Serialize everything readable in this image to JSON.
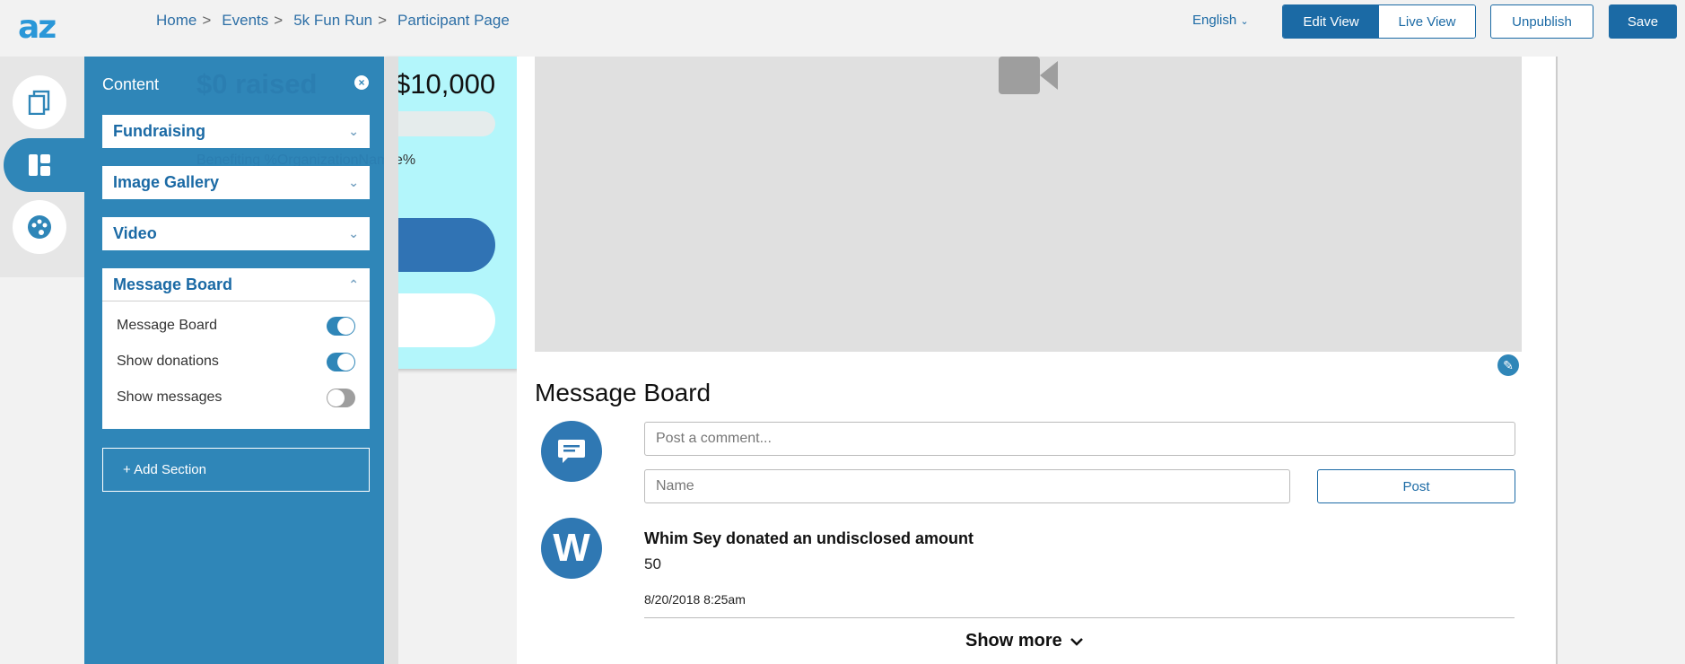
{
  "header": {
    "logo": "az",
    "breadcrumbs": [
      "Home",
      "Events",
      "5k Fun Run",
      "Participant Page"
    ],
    "breadcrumb_separator": ">",
    "language": "English",
    "edit_view": "Edit View",
    "live_view": "Live View",
    "unpublish": "Unpublish",
    "save": "Save"
  },
  "rail": {
    "items": [
      {
        "icon": "pages-icon"
      },
      {
        "icon": "layout-icon",
        "active": true
      },
      {
        "icon": "palette-icon"
      }
    ]
  },
  "panel": {
    "title": "Content",
    "sections": [
      "Fundraising",
      "Image Gallery",
      "Video",
      "Message Board"
    ],
    "expanded": {
      "title": "Message Board",
      "options": [
        {
          "label": "Message Board",
          "on": true
        },
        {
          "label": "Show donations",
          "on": true
        },
        {
          "label": "Show messages",
          "on": false
        }
      ]
    },
    "add_section": "+ Add Section"
  },
  "fundraising": {
    "raised": "$0 raised",
    "goal": "$10,000",
    "benefiting": "Benefiting %OrganizationName%"
  },
  "message_board": {
    "title": "Message Board",
    "comment_placeholder": "Post a comment...",
    "name_placeholder": "Name",
    "post_label": "Post",
    "entries": [
      {
        "initial": "W",
        "name": "Whim Sey donated an undisclosed amount",
        "amount": "50",
        "date": "8/20/2018 8:25am"
      }
    ],
    "show_more": "Show more"
  },
  "colors": {
    "primary": "#1b6aa5",
    "panel": "#2f86b8",
    "fund_card": "#b3f6fb"
  }
}
